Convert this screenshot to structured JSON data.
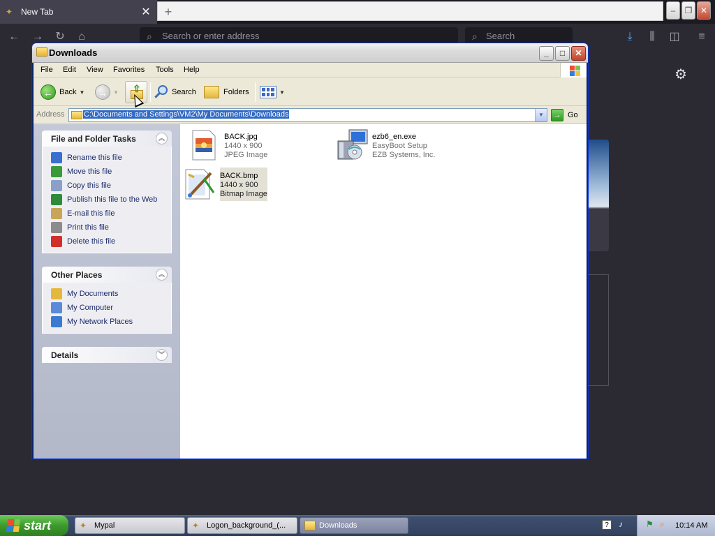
{
  "browser": {
    "tab_title": "New Tab",
    "tab_close": "✕",
    "new_tab": "+",
    "url_placeholder": "Search or enter address",
    "search_placeholder": "Search"
  },
  "window": {
    "title": "Downloads",
    "minimize": "_",
    "maximize": "□",
    "close": "✕"
  },
  "menu": [
    "File",
    "Edit",
    "View",
    "Favorites",
    "Tools",
    "Help"
  ],
  "toolbar": {
    "back": "Back",
    "search": "Search",
    "folders": "Folders"
  },
  "address": {
    "label": "Address",
    "path": "C:\\Documents and Settings\\VM2\\My Documents\\Downloads",
    "go": "Go"
  },
  "tasks": {
    "file_folder": {
      "title": "File and Folder Tasks",
      "items": [
        {
          "label": "Rename this file",
          "icon": "rename-icon",
          "color": "#3a6fd0"
        },
        {
          "label": "Move this file",
          "icon": "move-icon",
          "color": "#3a9a3a"
        },
        {
          "label": "Copy this file",
          "icon": "copy-icon",
          "color": "#8aa0c8"
        },
        {
          "label": "Publish this file to the Web",
          "icon": "globe-icon",
          "color": "#2e8b3a"
        },
        {
          "label": "E-mail this file",
          "icon": "email-icon",
          "color": "#c9a55a"
        },
        {
          "label": "Print this file",
          "icon": "printer-icon",
          "color": "#8c8c8c"
        },
        {
          "label": "Delete this file",
          "icon": "delete-icon",
          "color": "#d0302a"
        }
      ]
    },
    "other_places": {
      "title": "Other Places",
      "items": [
        {
          "label": "My Documents",
          "icon": "my-documents-icon",
          "color": "#e5b83c"
        },
        {
          "label": "My Computer",
          "icon": "my-computer-icon",
          "color": "#5a8ad8"
        },
        {
          "label": "My Network Places",
          "icon": "network-places-icon",
          "color": "#3a7ad0"
        }
      ]
    },
    "details": {
      "title": "Details"
    }
  },
  "files": [
    {
      "name": "BACK.jpg",
      "line2": "1440 x 900",
      "line3": "JPEG Image",
      "icon": "jpeg-image-icon"
    },
    {
      "name": "ezb6_en.exe",
      "line2": "EasyBoot Setup",
      "line3": "EZB Systems, Inc.",
      "icon": "setup-exe-icon"
    },
    {
      "name": "BACK.bmp",
      "line2": "1440 x 900",
      "line3": "Bitmap Image",
      "icon": "bitmap-image-icon"
    }
  ],
  "taskbar": {
    "start": "start",
    "items": [
      {
        "label": "Mypal"
      },
      {
        "label": "Logon_background_(..."
      },
      {
        "label": "Downloads"
      }
    ],
    "clock": "10:14 AM"
  }
}
